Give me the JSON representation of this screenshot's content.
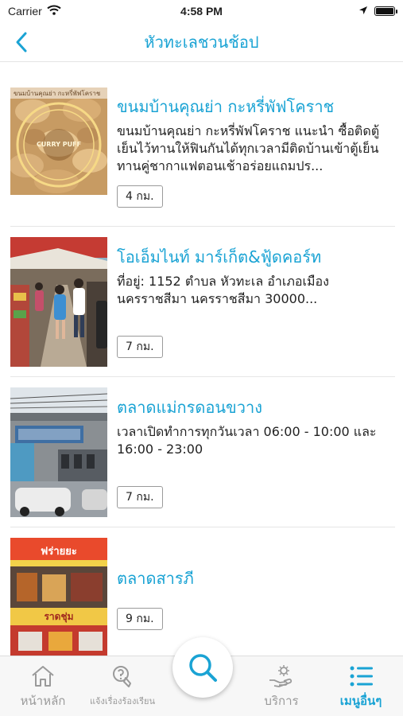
{
  "status_bar": {
    "carrier": "Carrier",
    "time": "4:58 PM"
  },
  "header": {
    "title": "หัวทะเลชวนช้อป"
  },
  "items": [
    {
      "title": "ขนมบ้านคุณย่า กะหรี่พัฟโคราช",
      "description": "ขนมบ้านคุณย่า กะหรี่พัฟโคราช แนะนำ ซื้อติดตู้เย็นไว้ทานให้ฟินกันได้ทุกเวลามีติดบ้านเข้าตู้เย็นทานคู่ชากาแฟตอนเช้าอร่อยแถมปร...",
      "distance": "4 กม.",
      "image_text_top": "ขนมบ้านคุณย่า กะหรี่พัฟโคราช",
      "image_text_badge": "CURRY PUFF"
    },
    {
      "title": "โอเอ็มไนท์ มาร์เก็ต&ฟู้ดคอร์ท",
      "description": "ที่อยู่: 1152 ตำบล หัวทะเล อำเภอเมือง นครราชสีมา นครราชสีมา 30000...",
      "distance": "7 กม."
    },
    {
      "title": "ตลาดแม่กรดอนขวาง",
      "description": "เวลาเปิดทำการทุกวันเวลา   06:00 - 10:00 และ 16:00 - 23:00",
      "distance": "7 กม."
    },
    {
      "title": "ตลาดสารภี",
      "description": "",
      "distance": "9 กม.",
      "image_text_top": "ฟร่ายยะ",
      "image_text_bottom": "ราดชุ่ม"
    }
  ],
  "tabs": [
    {
      "label": "หน้าหลัก",
      "icon": "home-icon"
    },
    {
      "label": "แจ้งเรื่องร้องเรียน",
      "icon": "complaint-icon"
    },
    {
      "label": "",
      "icon": "search-icon"
    },
    {
      "label": "บริการ",
      "icon": "service-hand-icon"
    },
    {
      "label": "เมนูอื่นๆ",
      "icon": "list-menu-icon"
    }
  ],
  "colors": {
    "accent": "#1aa3d4",
    "inactive": "#9a9a9a",
    "divider": "#e6e6e6"
  }
}
